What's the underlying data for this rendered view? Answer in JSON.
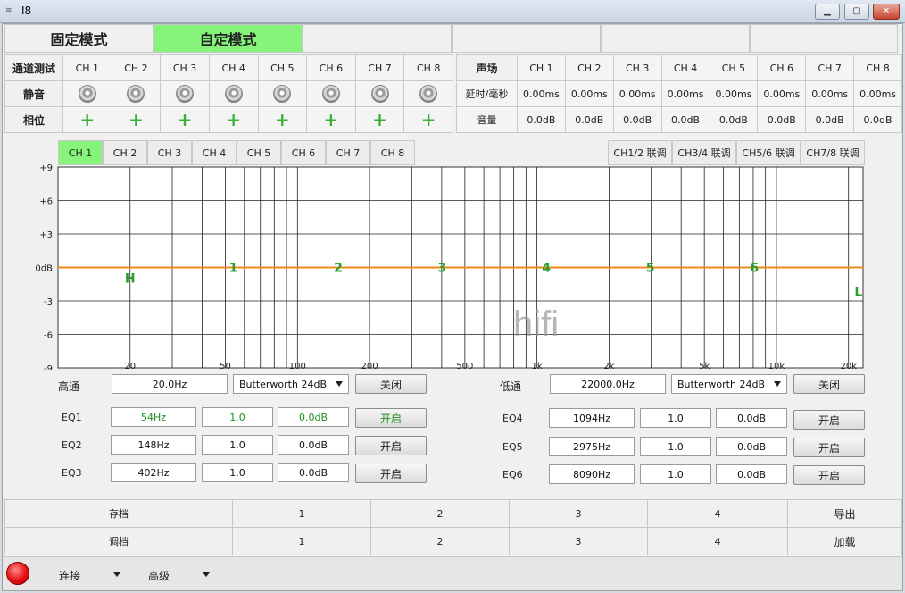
{
  "window": {
    "title": "I8"
  },
  "modes": {
    "fixed": "固定模式",
    "custom": "自定模式"
  },
  "channel_test": {
    "header": "通道测试",
    "channels": [
      "CH 1",
      "CH 2",
      "CH 3",
      "CH 4",
      "CH 5",
      "CH 6",
      "CH 7",
      "CH 8"
    ],
    "mute_label": "静音",
    "phase_label": "相位"
  },
  "sound_field": {
    "header": "声场",
    "channels": [
      "CH 1",
      "CH 2",
      "CH 3",
      "CH 4",
      "CH 5",
      "CH 6",
      "CH 7",
      "CH 8"
    ],
    "delay_label": "延时/毫秒",
    "delays": [
      "0.00ms",
      "0.00ms",
      "0.00ms",
      "0.00ms",
      "0.00ms",
      "0.00ms",
      "0.00ms",
      "0.00ms"
    ],
    "volume_label": "音量",
    "volumes": [
      "0.0dB",
      "0.0dB",
      "0.0dB",
      "0.0dB",
      "0.0dB",
      "0.0dB",
      "0.0dB",
      "0.0dB"
    ]
  },
  "eq_tabs": [
    "CH 1",
    "CH 2",
    "CH 3",
    "CH 4",
    "CH 5",
    "CH 6",
    "CH 7",
    "CH 8"
  ],
  "link_tabs": [
    "CH1/2 联调",
    "CH3/4 联调",
    "CH5/6 联调",
    "CH7/8 联调"
  ],
  "chart_data": {
    "type": "line",
    "y_ticks": [
      "+9",
      "+6",
      "+3",
      "0dB",
      "-3",
      "-6",
      "-9"
    ],
    "x_ticks": [
      "20",
      "50",
      "100",
      "200",
      "500",
      "1k",
      "2k",
      "5k",
      "10k",
      "20k"
    ],
    "ylim": [
      -9,
      9
    ],
    "xscale": "log",
    "series": [
      {
        "values": [
          0,
          0
        ]
      }
    ],
    "markers": [
      "H",
      "1",
      "2",
      "3",
      "4",
      "5",
      "6",
      "L"
    ],
    "line_color": "#ef8a1a",
    "marker_color": "#2a9d2a",
    "watermark": "hifi"
  },
  "highpass": {
    "label": "高通",
    "freq": "20.0Hz",
    "type": "Butterworth 24dB",
    "button": "关闭"
  },
  "lowpass": {
    "label": "低通",
    "freq": "22000.0Hz",
    "type": "Butterworth 24dB",
    "button": "关闭"
  },
  "eq": [
    {
      "label": "EQ1",
      "freq": "54Hz",
      "q": "1.0",
      "gain": "0.0dB",
      "button": "开启"
    },
    {
      "label": "EQ2",
      "freq": "148Hz",
      "q": "1.0",
      "gain": "0.0dB",
      "button": "开启"
    },
    {
      "label": "EQ3",
      "freq": "402Hz",
      "q": "1.0",
      "gain": "0.0dB",
      "button": "开启"
    },
    {
      "label": "EQ4",
      "freq": "1094Hz",
      "q": "1.0",
      "gain": "0.0dB",
      "button": "开启"
    },
    {
      "label": "EQ5",
      "freq": "2975Hz",
      "q": "1.0",
      "gain": "0.0dB",
      "button": "开启"
    },
    {
      "label": "EQ6",
      "freq": "8090Hz",
      "q": "1.0",
      "gain": "0.0dB",
      "button": "开启"
    }
  ],
  "presets": {
    "save_label": "存档",
    "load_label": "调档",
    "slots": [
      "1",
      "2",
      "3",
      "4"
    ],
    "export_label": "导出",
    "import_label": "加载"
  },
  "statusbar": {
    "connect": "连接",
    "advanced": "高级"
  }
}
